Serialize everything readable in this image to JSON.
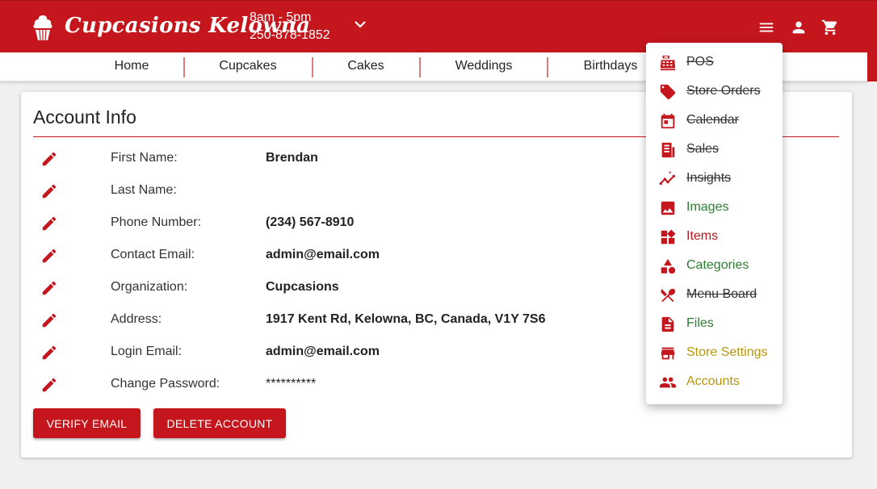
{
  "header": {
    "brand": "Cupcasions Kelowna",
    "hours": "8am - 5pm",
    "phone": "250-878-1852",
    "icons": [
      "cupcake-logo-icon",
      "chevron-down-icon",
      "menu-icon",
      "account-icon",
      "cart-icon"
    ]
  },
  "nav": {
    "items": [
      "Home",
      "Cupcakes",
      "Cakes",
      "Weddings",
      "Birthdays"
    ]
  },
  "account": {
    "title": "Account Info",
    "fields": [
      {
        "label": "First Name:",
        "value": "Brendan"
      },
      {
        "label": "Last Name:",
        "value": ""
      },
      {
        "label": "Phone Number:",
        "value": "(234) 567-8910"
      },
      {
        "label": "Contact Email:",
        "value": "admin@email.com"
      },
      {
        "label": "Organization:",
        "value": "Cupcasions"
      },
      {
        "label": "Address:",
        "value": "1917 Kent Rd, Kelowna, BC, Canada, V1Y 7S6"
      },
      {
        "label": "Login Email:",
        "value": "admin@email.com"
      },
      {
        "label": "Change Password:",
        "value": "**********"
      }
    ],
    "verify_label": "VERIFY EMAIL",
    "delete_label": "DELETE ACCOUNT"
  },
  "menu": {
    "items": [
      {
        "label": "POS",
        "icon": "cash-register-icon",
        "status": "disabled",
        "color": "#333333"
      },
      {
        "label": "Store Orders",
        "icon": "tag-icon",
        "status": "disabled",
        "color": "#333333"
      },
      {
        "label": "Calendar",
        "icon": "calendar-icon",
        "status": "disabled",
        "color": "#333333"
      },
      {
        "label": "Sales",
        "icon": "receipt-icon",
        "status": "disabled",
        "color": "#333333"
      },
      {
        "label": "Insights",
        "icon": "insights-icon",
        "status": "disabled",
        "color": "#333333"
      },
      {
        "label": "Images",
        "icon": "image-icon",
        "status": "enabled",
        "color": "#2e7d32"
      },
      {
        "label": "Items",
        "icon": "widgets-icon",
        "status": "enabled",
        "color": "#b71c1c"
      },
      {
        "label": "Categories",
        "icon": "shapes-icon",
        "status": "enabled",
        "color": "#2e7d32"
      },
      {
        "label": "Menu Board",
        "icon": "utensils-icon",
        "status": "disabled",
        "color": "#333333"
      },
      {
        "label": "Files",
        "icon": "file-icon",
        "status": "enabled",
        "color": "#2e7d32"
      },
      {
        "label": "Store Settings",
        "icon": "store-icon",
        "status": "enabled",
        "color": "#b8960b"
      },
      {
        "label": "Accounts",
        "icon": "people-icon",
        "status": "enabled",
        "color": "#b8960b"
      }
    ]
  },
  "colors": {
    "brand_red": "#c4161c",
    "enabled_green": "#2e7d32",
    "item_red": "#b71c1c",
    "gold": "#b8960b"
  }
}
